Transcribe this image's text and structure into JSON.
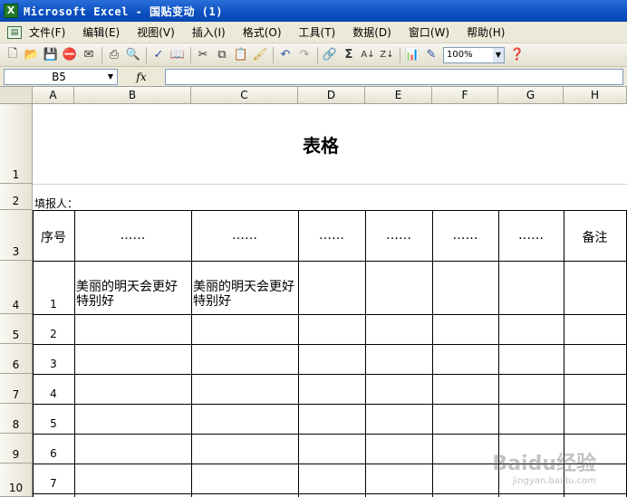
{
  "window": {
    "title": "Microsoft Excel - 国贴变动 (1)"
  },
  "menu": [
    "文件(F)",
    "编辑(E)",
    "视图(V)",
    "插入(I)",
    "格式(O)",
    "工具(T)",
    "数据(D)",
    "窗口(W)",
    "帮助(H)"
  ],
  "toolbar": {
    "icons": [
      "new-icon",
      "open-icon",
      "save-icon",
      "permission-icon",
      "email-icon",
      "print-icon",
      "print-preview-icon",
      "spelling-icon",
      "research-icon",
      "cut-icon",
      "copy-icon",
      "paste-icon",
      "format-painter-icon",
      "undo-icon",
      "redo-icon",
      "hyperlink-icon",
      "autosum-icon",
      "sort-ascending-icon",
      "sort-descending-icon",
      "chart-wizard-icon",
      "drawing-icon",
      "help-icon"
    ],
    "zoom": "100%"
  },
  "formula_bar": {
    "name_box": "B5",
    "fx": "fx",
    "formula": ""
  },
  "columns": [
    "A",
    "B",
    "C",
    "D",
    "E",
    "F",
    "G",
    "H"
  ],
  "rows": [
    "1",
    "2",
    "3",
    "4",
    "5",
    "6",
    "7",
    "8",
    "9",
    "10"
  ],
  "sheet": {
    "title": "表格",
    "reporter_label": "填报人：",
    "headers": [
      "序号",
      "……",
      "……",
      "……",
      "……",
      "……",
      "……",
      "备注"
    ],
    "row4_text_b": "美丽的明天会更好特别好",
    "row4_text_c": "美丽的明天会更好特别好",
    "seq_numbers": [
      "1",
      "2",
      "3",
      "4",
      "5",
      "6",
      "7"
    ]
  },
  "watermark": {
    "main": "Baidu经验",
    "sub": "jingyan.baidu.com"
  }
}
